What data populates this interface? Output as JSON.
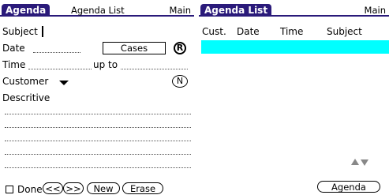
{
  "agenda": {
    "title": "Agenda",
    "menu_list": "Agenda List",
    "menu_main": "Main",
    "subject_label": "Subject",
    "date_label": "Date",
    "cases_button": "Cases",
    "r_badge": "R",
    "time_label": "Time",
    "up_to_label": "up to",
    "customer_label": "Customer",
    "n_badge": "N",
    "descriptive_label": "Descritive",
    "done_label": "Done",
    "prev_button": "<<",
    "next_button": ">>",
    "new_button": "New",
    "erase_button": "Erase"
  },
  "agenda_list": {
    "title": "Agenda List",
    "menu_main": "Main",
    "columns": [
      "Cust.",
      "Date",
      "Time",
      "Subject"
    ],
    "agenda_button": "Agenda"
  }
}
